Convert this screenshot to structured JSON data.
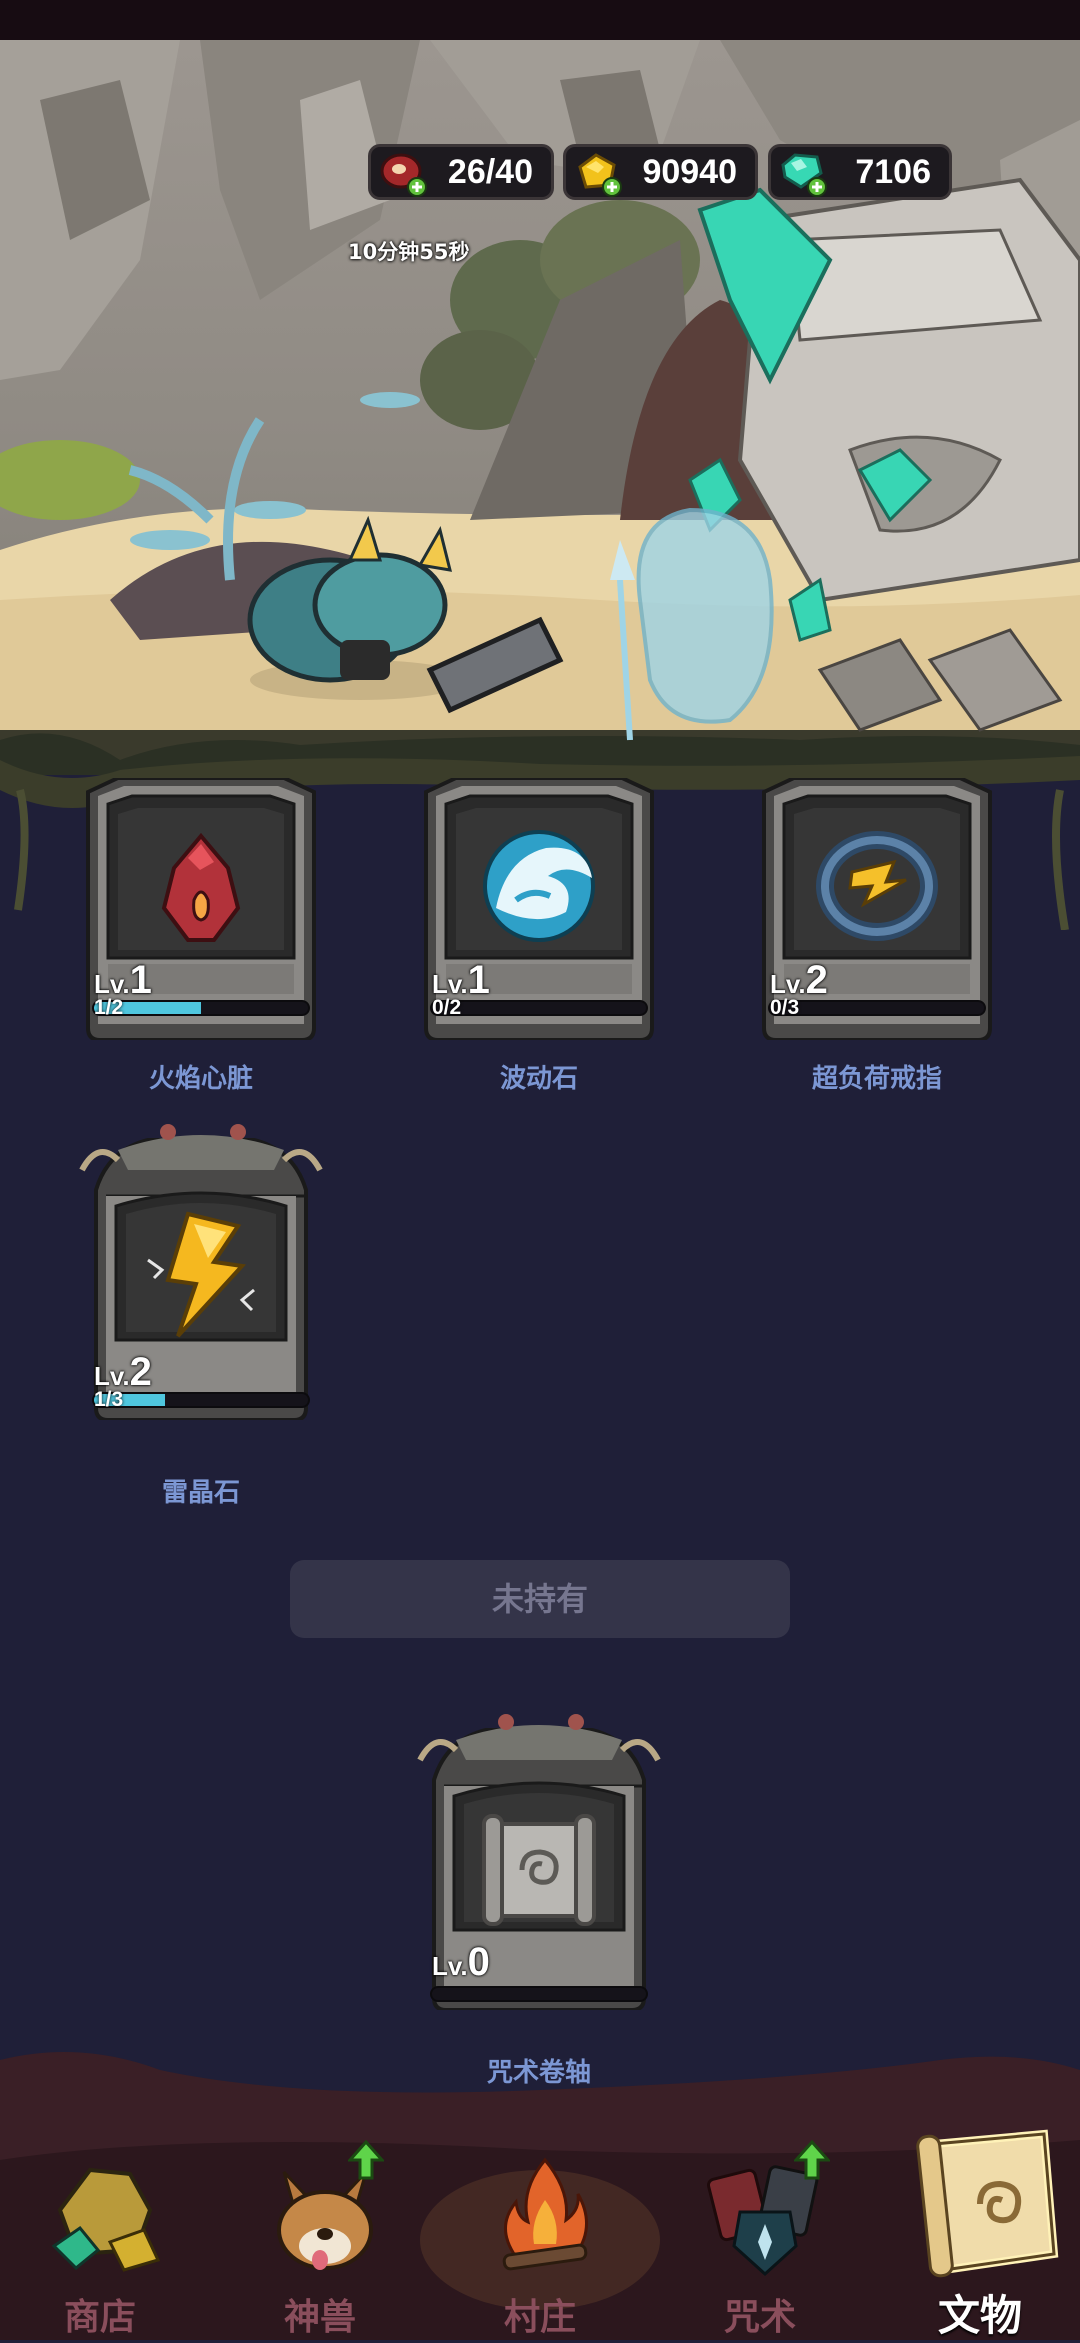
{
  "resources": {
    "meat": {
      "value": "26/40",
      "icon": "meat-icon",
      "timer": "10分钟55秒"
    },
    "gold": {
      "value": "90940",
      "icon": "gold-icon"
    },
    "gem": {
      "value": "7106",
      "icon": "gem-icon"
    }
  },
  "relics": [
    {
      "name": "火焰心脏",
      "lv_prefix": "Lv.",
      "level": "1",
      "count": "1/2",
      "progress": 0.5,
      "icon": "fire-heart-icon"
    },
    {
      "name": "波动石",
      "lv_prefix": "Lv.",
      "level": "1",
      "count": "0/2",
      "progress": 0,
      "icon": "wave-stone-icon"
    },
    {
      "name": "超负荷戒指",
      "lv_prefix": "Lv.",
      "level": "2",
      "count": "0/3",
      "progress": 0,
      "icon": "overload-ring-icon"
    },
    {
      "name": "雷晶石",
      "lv_prefix": "Lv.",
      "level": "2",
      "count": "1/3",
      "progress": 0.333,
      "icon": "thunder-crystal-icon"
    }
  ],
  "unowned": {
    "label": "未持有",
    "items": [
      {
        "name": "咒术卷轴",
        "lv_prefix": "Lv.",
        "level": "0",
        "icon": "spell-scroll-icon"
      }
    ]
  },
  "nav": [
    {
      "label": "商店",
      "icon": "shop-ore-icon",
      "badge": false
    },
    {
      "label": "神兽",
      "icon": "beast-corgi-icon",
      "badge": true
    },
    {
      "label": "村庄",
      "icon": "campfire-icon",
      "badge": false
    },
    {
      "label": "咒术",
      "icon": "spell-cards-icon",
      "badge": true
    },
    {
      "label": "文物",
      "icon": "relic-scroll-icon",
      "badge": false,
      "active": true
    }
  ],
  "colors": {
    "background": "#1f1f38",
    "progress": "#4fc6de",
    "relic_name": "#7c97d4",
    "nav_label": "#8a4e5c"
  }
}
